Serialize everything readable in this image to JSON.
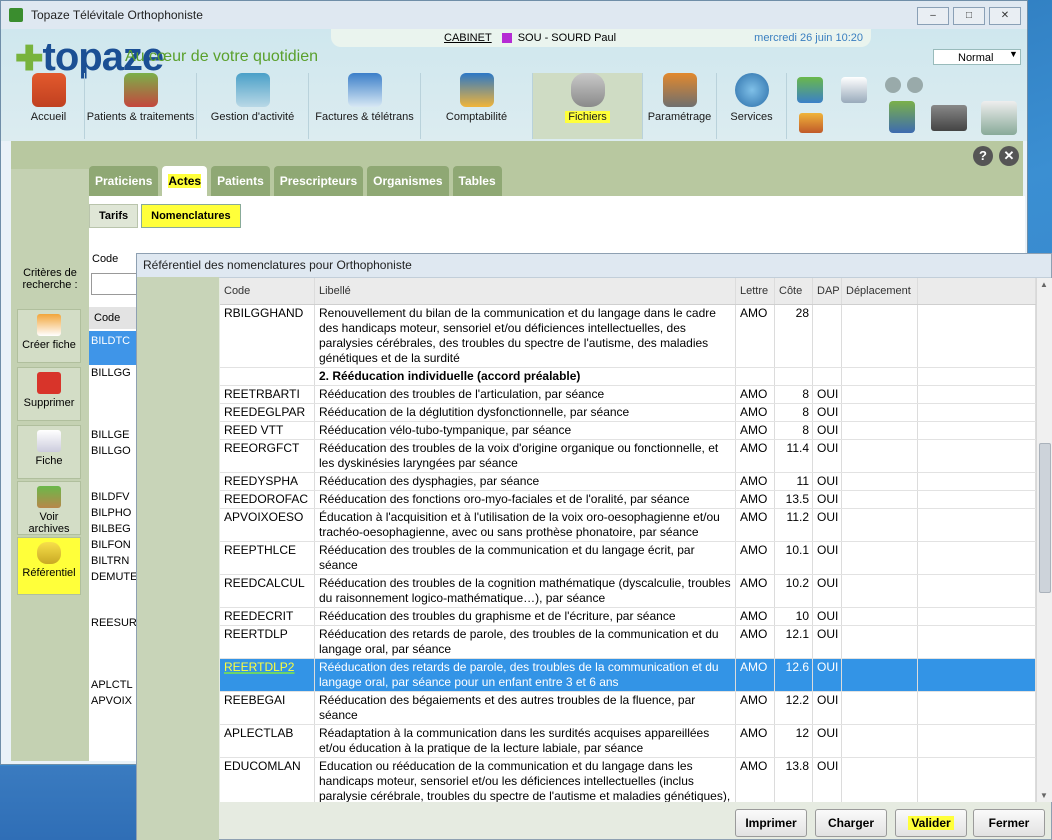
{
  "window": {
    "title": "Topaze Télévitale Orthophoniste",
    "controls": [
      "minimize",
      "maximize",
      "close"
    ]
  },
  "header": {
    "logo": "topaze",
    "tagline": "Au cœur de votre quotidien",
    "cabinet_label": "CABINET",
    "user": "SOU - SOURD Paul",
    "datetime": "mercredi 26 juin 10:20",
    "mode": "Normal",
    "user_color": "#b52bd4"
  },
  "nav": {
    "items": [
      {
        "label": "Accueil",
        "icon": "house-icon"
      },
      {
        "label": "Patients & traitements",
        "icon": "patients-icon"
      },
      {
        "label": "Gestion d'activité",
        "icon": "activity-icon"
      },
      {
        "label": "Factures & télétrans",
        "icon": "invoices-icon"
      },
      {
        "label": "Comptabilité",
        "icon": "calculator-icon"
      },
      {
        "label": "Fichiers",
        "icon": "database-icon",
        "active": true
      },
      {
        "label": "Paramétrage",
        "icon": "settings-icon"
      },
      {
        "label": "Services",
        "icon": "globe-icon"
      }
    ]
  },
  "tabs": [
    "Praticiens",
    "Actes",
    "Patients",
    "Prescripteurs",
    "Organismes",
    "Tables"
  ],
  "active_tab": "Actes",
  "subtabs": [
    "Tarifs",
    "Nomenclatures"
  ],
  "active_subtab": "Nomenclatures",
  "background": {
    "code_label": "Code",
    "column_header": "Code",
    "selected_code": "BILDTC",
    "codes": [
      "BILLGG",
      "BILLGE",
      "BILLGO",
      "BILDFV",
      "BILPHO",
      "BILBEG",
      "BILFON",
      "BILTRN",
      "DEMUTE",
      "REESUR",
      "APLCTL",
      "APVOIX"
    ]
  },
  "sidebar": {
    "criteria_label": "Critères de recherche :",
    "buttons": [
      {
        "label": "Créer fiche",
        "icon": "new-file-icon"
      },
      {
        "label": "Supprimer",
        "icon": "delete-icon"
      },
      {
        "label": "Fiche",
        "icon": "file-icon"
      },
      {
        "label": "Voir archives",
        "icon": "archive-box-icon"
      },
      {
        "label": "Référentiel",
        "icon": "database-icon",
        "highlighted": true
      }
    ]
  },
  "dialog": {
    "title": "Référentiel des nomenclatures pour Orthophoniste",
    "columns": [
      "Code",
      "Libellé",
      "Lettre",
      "Côte",
      "DAP",
      "Déplacement"
    ],
    "rows": [
      {
        "code": "RBILGGHAND",
        "label": "Renouvellement du bilan de la communication et du langage dans le cadre des handicaps moteur, sensoriel et/ou déficiences intellectuelles, des paralysies cérébrales, des troubles du spectre de l'autisme, des maladies génétiques et de la surdité",
        "lettre": "AMO",
        "cote": "28",
        "dap": "",
        "dep": ""
      },
      {
        "code": "",
        "label": "2. Rééducation individuelle (accord préalable)",
        "lettre": "",
        "cote": "",
        "dap": "",
        "dep": "",
        "section": true
      },
      {
        "code": "REETRBARTI",
        "label": "Rééducation des troubles de l'articulation, par séance",
        "lettre": "AMO",
        "cote": "8",
        "dap": "OUI",
        "dep": ""
      },
      {
        "code": "REEDEGLPAR",
        "label": "Rééducation de la déglutition dysfonctionnelle, par séance",
        "lettre": "AMO",
        "cote": "8",
        "dap": "OUI",
        "dep": ""
      },
      {
        "code": "REED VTT",
        "label": "Rééducation vélo-tubo-tympanique, par séance",
        "lettre": "AMO",
        "cote": "8",
        "dap": "OUI",
        "dep": ""
      },
      {
        "code": "REEORGFCT",
        "label": "Rééducation des troubles de la voix d'origine organique ou fonctionnelle, et les dyskinésies laryngées par séance",
        "lettre": "AMO",
        "cote": "11.4",
        "dap": "OUI",
        "dep": ""
      },
      {
        "code": "REEDYSPHA",
        "label": "Rééducation des dysphagies, par séance",
        "lettre": "AMO",
        "cote": "11",
        "dap": "OUI",
        "dep": ""
      },
      {
        "code": "REEDOROFAC",
        "label": "Rééducation des fonctions oro-myo-faciales et de l'oralité, par séance",
        "lettre": "AMO",
        "cote": "13.5",
        "dap": "OUI",
        "dep": ""
      },
      {
        "code": "APVOIXOESO",
        "label": "Éducation à l'acquisition et à l'utilisation de la voix oro-oesophagienne et/ou trachéo-oesophagienne, avec ou sans prothèse phonatoire, par séance",
        "lettre": "AMO",
        "cote": "11.2",
        "dap": "OUI",
        "dep": ""
      },
      {
        "code": "REEPTHLCE",
        "label": "Rééducation des troubles de la communication et du langage écrit, par séance",
        "lettre": "AMO",
        "cote": "10.1",
        "dap": "OUI",
        "dep": ""
      },
      {
        "code": "REEDCALCUL",
        "label": "Rééducation des troubles de la cognition mathématique (dyscalculie, troubles du raisonnement logico-mathématique…), par séance",
        "lettre": "AMO",
        "cote": "10.2",
        "dap": "OUI",
        "dep": ""
      },
      {
        "code": "REEDECRIT",
        "label": "Rééducation des troubles du graphisme et de l'écriture, par séance",
        "lettre": "AMO",
        "cote": "10",
        "dap": "OUI",
        "dep": ""
      },
      {
        "code": "REERTDLP",
        "label": "Rééducation des retards de parole, des troubles de la communication et du langage oral, par séance",
        "lettre": "AMO",
        "cote": "12.1",
        "dap": "OUI",
        "dep": ""
      },
      {
        "code": "REERTDLP2",
        "label": "Rééducation des retards de parole, des troubles de la communication et du langage oral, par séance pour un enfant entre 3 et 6 ans",
        "lettre": "AMO",
        "cote": "12.6",
        "dap": "OUI",
        "dep": "",
        "selected": true
      },
      {
        "code": "REEBEGAI",
        "label": "Rééducation des bégaiements et des autres troubles de la fluence, par séance",
        "lettre": "AMO",
        "cote": "12.2",
        "dap": "OUI",
        "dep": ""
      },
      {
        "code": "APLECTLAB",
        "label": "Réadaptation à la communication dans les surdités acquises appareillées et/ou éducation à la pratique de la lecture labiale, par séance",
        "lettre": "AMO",
        "cote": "12",
        "dap": "OUI",
        "dep": ""
      },
      {
        "code": "EDUCOMLAN",
        "label": "Education ou rééducation de la communication et du langage dans les handicaps moteur, sensoriel et/ou les déficiences intellectuelles (inclus paralysie cérébrale, troubles du spectre de l'autisme et maladies génétiques), par séance",
        "lettre": "AMO",
        "cote": "13.8",
        "dap": "OUI",
        "dep": ""
      }
    ],
    "buttons": {
      "print": "Imprimer",
      "load": "Charger",
      "validate": "Valider",
      "close": "Fermer"
    }
  },
  "colors": {
    "highlight": "#ffff3a",
    "selection": "#3394e6",
    "tab_green": "#8fa874"
  }
}
